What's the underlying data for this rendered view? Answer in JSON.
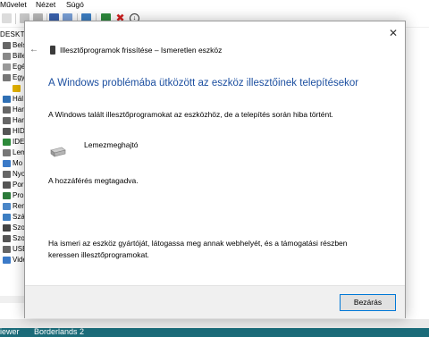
{
  "menu": {
    "action": "Művelet",
    "view": "Nézet",
    "help": "Súgó"
  },
  "tree": {
    "root": "DESKTO",
    "items": [
      "Bels",
      "Bille",
      "Egé",
      "Egy",
      "",
      "Hál",
      "Har",
      "Har",
      "HID",
      "IDE",
      "Lem",
      "Mo",
      "Nyo",
      "Por",
      "Pro",
      "Ren",
      "Szá",
      "Szo",
      "Szo",
      "USE",
      "Vide"
    ]
  },
  "taskbar": {
    "left": "iewer",
    "app": "Borderlands 2"
  },
  "dialog": {
    "title": "Illesztőprogramok frissítése – Ismeretlen eszköz",
    "heading": "A Windows problémába ütközött az eszköz illesztőinek telepítésekor",
    "found_text": "A Windows talált illesztőprogramokat az eszközhöz, de a telepítés során hiba történt.",
    "device_name": "Lemezmeghajtó",
    "error_text": "A hozzáférés megtagadva.",
    "help_text": "Ha ismeri az eszköz gyártóját, látogassa meg annak webhelyét, és a támogatási részben keressen illesztőprogramokat.",
    "close_button": "Bezárás",
    "close_glyph": "✕",
    "back_glyph": "←"
  },
  "colors": {
    "heading": "#1c4fa0",
    "button_border": "#0078d7",
    "taskbar": "#1b6b79"
  }
}
